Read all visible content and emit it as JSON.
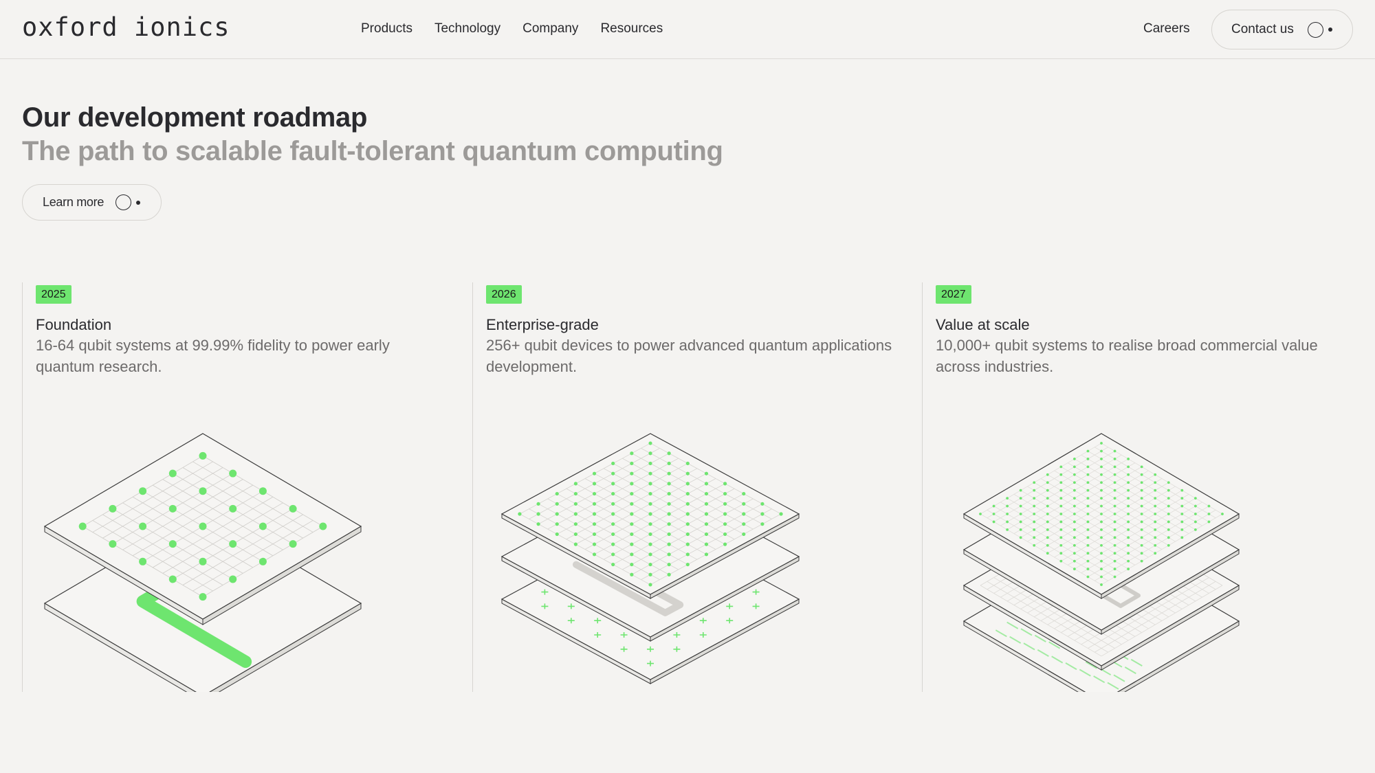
{
  "header": {
    "logo": "oxford ionics",
    "nav": [
      "Products",
      "Technology",
      "Company",
      "Resources"
    ],
    "careers": "Careers",
    "contact": "Contact us"
  },
  "hero": {
    "title": "Our development roadmap",
    "subtitle": "The path to scalable fault-tolerant quantum computing",
    "cta": "Learn more"
  },
  "roadmap": [
    {
      "year": "2025",
      "title": "Foundation",
      "description": "16-64 qubit systems at 99.99% fidelity to power early quantum research."
    },
    {
      "year": "2026",
      "title": "Enterprise-grade",
      "description": "256+ qubit devices to power advanced quantum applications development."
    },
    {
      "year": "2027",
      "title": "Value at scale",
      "description": "10,000+ qubit systems to realise broad commercial value across industries."
    }
  ],
  "colors": {
    "background": "#f4f3f1",
    "accent_green": "#6ee56f",
    "text": "#2a2a2e",
    "muted": "#9c9a98"
  }
}
